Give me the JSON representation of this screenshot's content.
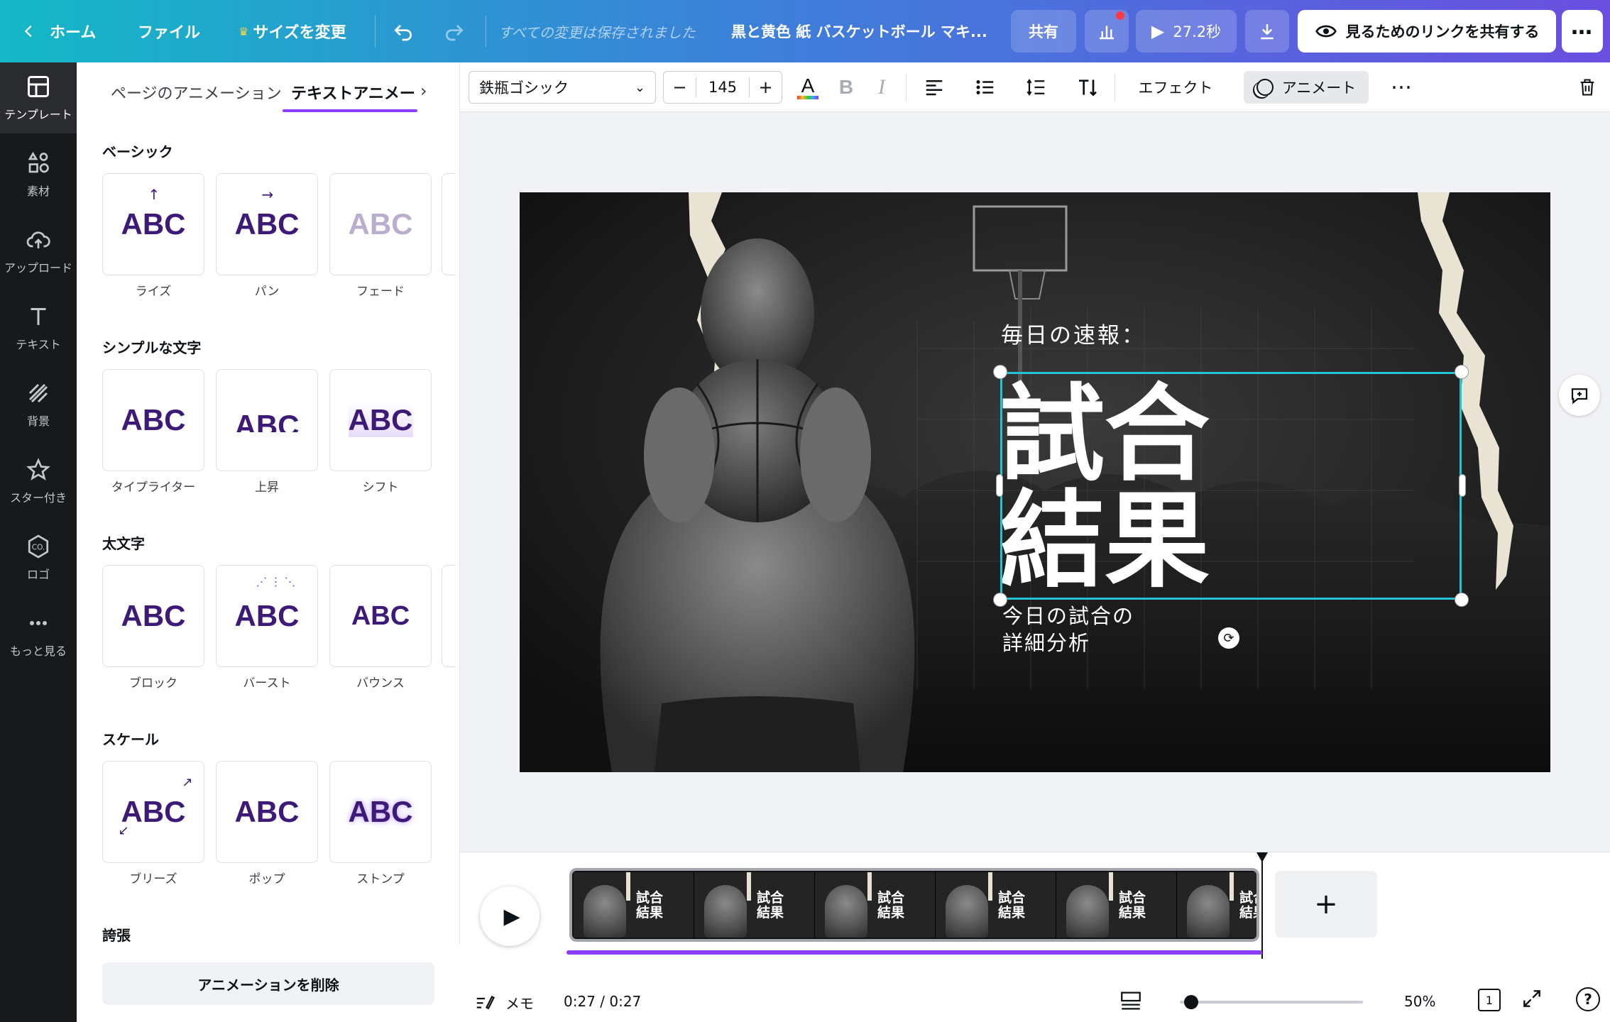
{
  "topbar": {
    "home": "ホーム",
    "file": "ファイル",
    "resize": "サイズを変更",
    "saved_status": "すべての変更は保存されました",
    "doc_title": "黒と黄色 紙 バスケットボール マキ...",
    "share": "共有",
    "duration": "27.2秒",
    "share_link": "見るためのリンクを共有する"
  },
  "rail": {
    "items": [
      {
        "label": "テンプレート",
        "icon": "template-icon"
      },
      {
        "label": "素材",
        "icon": "elements-icon"
      },
      {
        "label": "アップロード",
        "icon": "upload-icon"
      },
      {
        "label": "テキスト",
        "icon": "text-icon"
      },
      {
        "label": "背景",
        "icon": "background-icon"
      },
      {
        "label": "スター付き",
        "icon": "star-icon"
      },
      {
        "label": "ロゴ",
        "icon": "logo-icon"
      },
      {
        "label": "もっと見る",
        "icon": "more-icon"
      }
    ]
  },
  "panel": {
    "tabs": [
      "ページのアニメーション",
      "テキストアニメーション"
    ],
    "sections": [
      {
        "title": "ベーシック",
        "cards": [
          "ライズ",
          "パン",
          "フェード"
        ]
      },
      {
        "title": "シンプルな文字",
        "cards": [
          "タイプライター",
          "上昇",
          "シフト"
        ]
      },
      {
        "title": "太文字",
        "cards": [
          "ブロック",
          "バースト",
          "バウンス"
        ]
      },
      {
        "title": "スケール",
        "cards": [
          "ブリーズ",
          "ポップ",
          "ストンプ"
        ]
      },
      {
        "title": "誇張",
        "cards": []
      }
    ],
    "card_text": "ABC",
    "remove_button": "アニメーションを削除"
  },
  "toolbar": {
    "font": "鉄瓶ゴシック",
    "font_size": "145",
    "effects": "エフェクト",
    "animate": "アニメート"
  },
  "canvas": {
    "subtitle_top": "毎日の速報：",
    "headline_line1": "試合",
    "headline_line2": "結果",
    "sub_line1": "今日の試合の",
    "sub_line2": "詳細分析"
  },
  "timeline": {
    "thumb_line1": "試合",
    "thumb_line2": "結果",
    "memo": "メモ",
    "time": "0:27 / 0:27",
    "zoom": "50%",
    "page_count": "1",
    "progress": 1.0
  },
  "colors": {
    "accent": "#8b3dff",
    "selection": "#22c3d2",
    "card_text": "#3d1a78"
  }
}
